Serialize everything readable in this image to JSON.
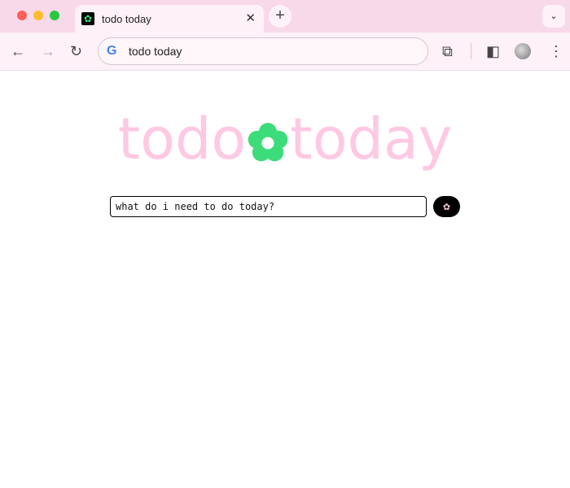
{
  "browser": {
    "tab_title": "todo today",
    "address": "todo today"
  },
  "page": {
    "logo_left": "todo",
    "logo_right": "today",
    "input_placeholder": "what do i need to do today?",
    "submit_glyph": "✿"
  },
  "colors": {
    "logo": "#ffc8e3",
    "flower": "#3ddc7a"
  }
}
